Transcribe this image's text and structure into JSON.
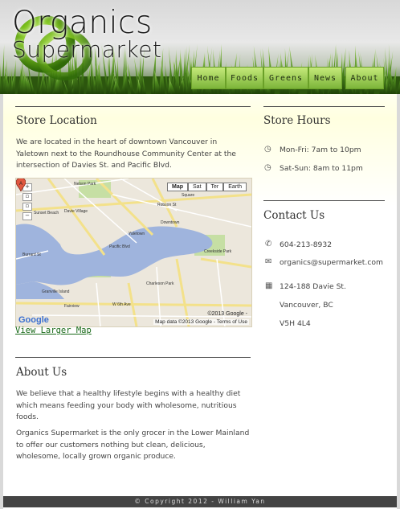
{
  "site": {
    "logo_line1": "Organics",
    "logo_line2": "Supermarket"
  },
  "nav": {
    "items": [
      {
        "label": "Home"
      },
      {
        "label": "Foods"
      },
      {
        "label": "Greens"
      },
      {
        "label": "News"
      },
      {
        "label": "About"
      }
    ]
  },
  "store_location": {
    "heading": "Store Location",
    "text": "We are located in the heart of downtown Vancouver in Yaletown next to the Roundhouse Community Center at the intersection of Davies St. and Pacific Blvd.",
    "view_larger_map": "View Larger Map"
  },
  "map": {
    "type_buttons": [
      "Map",
      "Sat",
      "Ter",
      "Earth"
    ],
    "copyright": "©2013 Google -",
    "attribution": "Map data ©2013 Google - Terms of Use",
    "logo": "Google",
    "marker_label": "A",
    "streets": [
      "Nelson Park",
      "Davie Village",
      "Sunset Beach",
      "Yaletown",
      "Downtown",
      "Granville Island",
      "Fairview",
      "W 6th Ave",
      "Creekside Park",
      "Charleson Park",
      "Square",
      "Pacific Blvd",
      "Burrard St",
      "Robson St"
    ]
  },
  "about": {
    "heading": "About Us",
    "para1": "We believe that a healthy lifestyle begins with a healthy diet which means feeding your body with wholesome, nutritious foods.",
    "para2": "Organics Supermarket is the only grocer in the Lower Mainland to offer our customers nothing but clean, delicious, wholesome, locally grown organic produce."
  },
  "store_hours": {
    "heading": "Store Hours",
    "rows": [
      {
        "text": "Mon-Fri: 7am to 10pm"
      },
      {
        "text": "Sat-Sun: 8am to 11pm"
      }
    ]
  },
  "contact": {
    "heading": "Contact Us",
    "phone": "604-213-8932",
    "email": "organics@supermarket.com",
    "address_line1": "124-188 Davie St.",
    "address_line2": "Vancouver, BC",
    "address_line3": "V5H 4L4"
  },
  "footer": {
    "text": "© Copyright 2012 - William Yan"
  },
  "colors": {
    "nav_green": "#7cb53a",
    "link_green": "#1a6a1a",
    "footer_bg": "#444444"
  }
}
